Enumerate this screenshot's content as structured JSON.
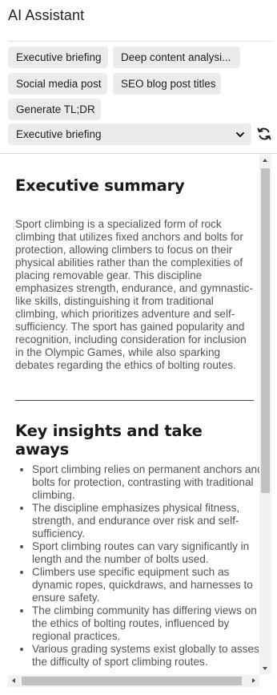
{
  "app": {
    "title": "AI Assistant"
  },
  "prompts": [
    {
      "label": "Executive briefing"
    },
    {
      "label": "Deep content analysi..."
    },
    {
      "label": "Social media post"
    },
    {
      "label": "SEO blog post titles"
    },
    {
      "label": "Generate TL;DR"
    }
  ],
  "selector": {
    "selected": "Executive briefing",
    "chevron_icon": "chevron-down-icon",
    "refresh_icon": "refresh-icon"
  },
  "output": {
    "summary_heading": "Executive summary",
    "summary_paragraph": "Sport climbing is a specialized form of rock climbing that utilizes fixed anchors and bolts for protection, allowing climbers to focus on their physical abilities rather than the complexities of placing removable gear. This discipline emphasizes strength, endurance, and gymnastic-like skills, distinguishing it from traditional climbing, which prioritizes adventure and self-sufficiency. The sport has gained popularity and recognition, including consideration for inclusion in the Olympic Games, while also sparking debates regarding the ethics of bolting routes.",
    "insights_heading": "Key insights and take aways",
    "insights": [
      "Sport climbing relies on permanent anchors and bolts for protection, contrasting with traditional climbing.",
      "The discipline emphasizes physical fitness, strength, and endurance over risk and self-sufficiency.",
      "Sport climbing routes can vary significantly in length and the number of bolts used.",
      "Climbers use specific equipment such as dynamic ropes, quickdraws, and harnesses to ensure safety.",
      "The climbing community has differing views on the ethics of bolting routes, influenced by regional practices.",
      "Various grading systems exist globally to assess the difficulty of sport climbing routes."
    ]
  },
  "colors": {
    "chip_bg": "#ebebeb",
    "text": "#555555",
    "heading": "#1a1a1a",
    "scroll_thumb": "#c1c1c1"
  }
}
